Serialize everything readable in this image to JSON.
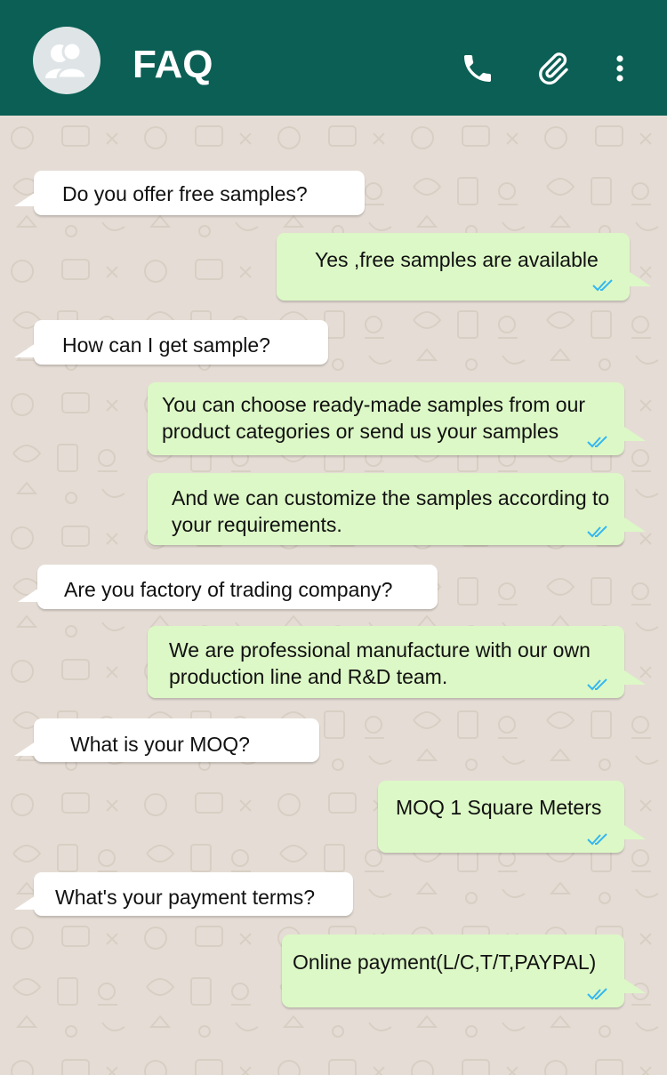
{
  "header": {
    "title": "FAQ",
    "background": "#0b5f54",
    "icons": [
      "group-avatar-icon",
      "phone-icon",
      "paperclip-icon",
      "more-vert-icon"
    ]
  },
  "colors": {
    "incoming_bubble": "#ffffff",
    "outgoing_bubble": "#dcf8c6",
    "chat_background": "#e5ddd5",
    "read_ticks": "#34b7f1"
  },
  "messages": [
    {
      "direction": "in",
      "text": "Do you offer free samples?"
    },
    {
      "direction": "out",
      "text": "Yes ,free samples are available"
    },
    {
      "direction": "in",
      "text": "How can I get sample?"
    },
    {
      "direction": "out",
      "text": "You can choose ready-made samples from our product categories or send us your samples"
    },
    {
      "direction": "out",
      "text": "And we can customize the samples according to your requirements."
    },
    {
      "direction": "in",
      "text": "Are you factory of trading company?"
    },
    {
      "direction": "out",
      "text": "We are professional manufacture with our own production line and R&D team."
    },
    {
      "direction": "in",
      "text": "What is your MOQ?"
    },
    {
      "direction": "out",
      "text": "MOQ 1 Square Meters"
    },
    {
      "direction": "in",
      "text": "What's your payment terms?"
    },
    {
      "direction": "out",
      "text": "Online payment(L/C,T/T,PAYPAL)"
    }
  ]
}
